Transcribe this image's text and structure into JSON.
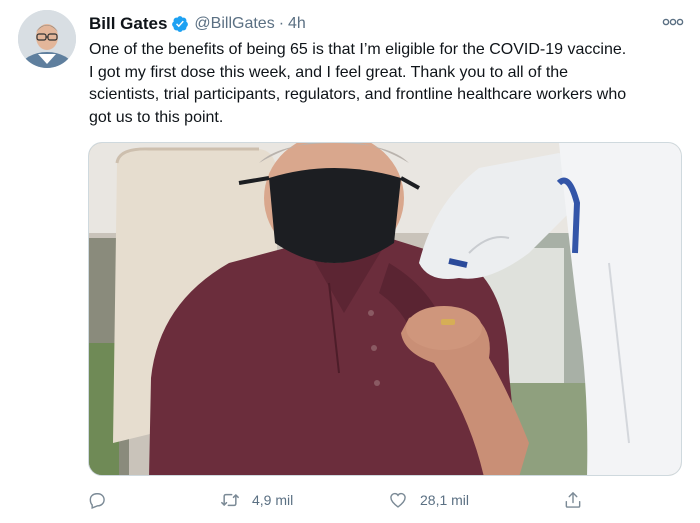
{
  "author": {
    "name": "Bill Gates",
    "handle": "@BillGates",
    "separator": "·",
    "time": "4h",
    "verified": true
  },
  "tweet": {
    "lines": [
      "One of the benefits of being 65 is that I’m eligible for the COVID-19 vaccine.",
      "I got my first dose this week, and I feel great. Thank you to all of the",
      "scientists, trial participants, regulators, and frontline healthcare workers who",
      "got us to this point."
    ]
  },
  "actions": {
    "retweets": "4,9 mil",
    "likes": "28,1 mil"
  },
  "icons": {
    "more": "more-horizontal-icon",
    "verified": "verified-badge-icon",
    "reply": "reply-icon",
    "retweet": "retweet-icon",
    "like": "heart-icon",
    "share": "share-icon"
  },
  "colors": {
    "accent": "#1da1f2",
    "text": "#0f1419",
    "secondary": "#5b7083",
    "retweet_icon": "#7b8a96"
  }
}
